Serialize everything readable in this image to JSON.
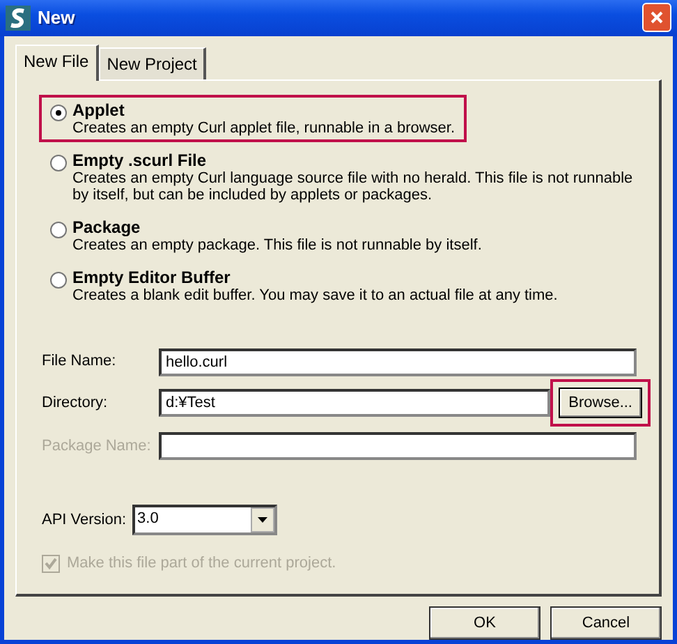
{
  "window": {
    "title": "New"
  },
  "tabs": [
    {
      "label": "New File",
      "selected": true
    },
    {
      "label": "New Project",
      "selected": false
    }
  ],
  "options": [
    {
      "title": "Applet",
      "description": "Creates an empty Curl applet file, runnable in a browser.",
      "selected": true,
      "highlighted": true
    },
    {
      "title": "Empty .scurl File",
      "description": "Creates an empty Curl language source file with no herald. This file is not runnable by itself, but can be included by applets or packages.",
      "selected": false,
      "highlighted": false
    },
    {
      "title": "Package",
      "description": "Creates an empty package. This file is not runnable by itself.",
      "selected": false,
      "highlighted": false
    },
    {
      "title": "Empty Editor Buffer",
      "description": "Creates a blank edit buffer. You may save it to an actual file at any time.",
      "selected": false,
      "highlighted": false
    }
  ],
  "fields": [
    {
      "label": "File Name:",
      "value": "hello.curl",
      "disabled": false
    },
    {
      "label": "Directory:",
      "value": "d:¥Test",
      "disabled": false,
      "button": {
        "label": "Browse...",
        "highlighted": true
      }
    },
    {
      "label": "Package Name:",
      "disabled": true
    }
  ],
  "api_version": {
    "label": "API Version:",
    "value": "3.0"
  },
  "project_checkbox": {
    "label": "Make this file part of the current project.",
    "checked": true,
    "disabled": true
  },
  "buttons": [
    "OK",
    "Cancel"
  ]
}
